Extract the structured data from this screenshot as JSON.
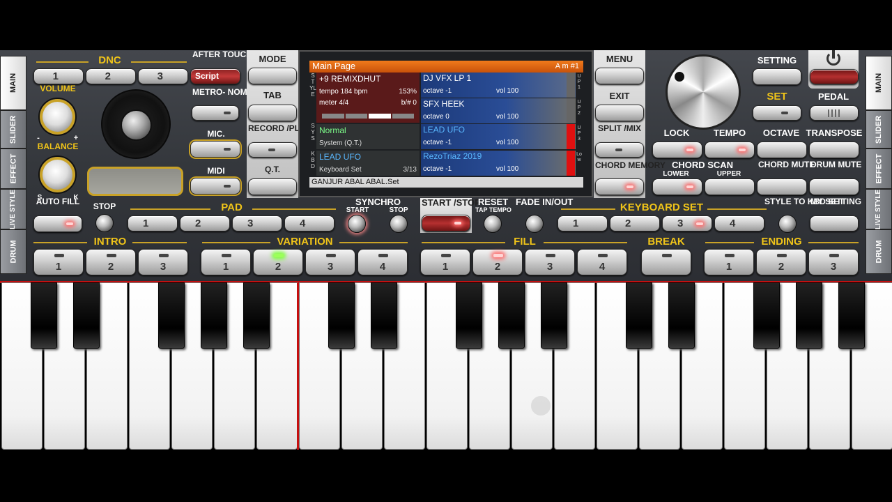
{
  "side_tabs_left": [
    "MAIN",
    "SLIDER",
    "EFFECT",
    "LIVE STYLE",
    "DRUM"
  ],
  "side_tabs_right": [
    "MAIN",
    "SLIDER",
    "EFFECT",
    "LIVE STYLE",
    "DRUM"
  ],
  "dnc": {
    "title": "DNC",
    "b1": "1",
    "b2": "2",
    "b3": "3",
    "script": "Script"
  },
  "after_touch": "AFTER TOUCH",
  "metronome": "METRO- NOME",
  "mic": "MIC.",
  "midi": "MIDI",
  "volume": "VOLUME",
  "balance": "BALANCE",
  "balance_s": "S",
  "balance_k": "K",
  "vol_minus": "-",
  "vol_plus": "+",
  "mode": "MODE",
  "tab": "TAB",
  "record_play": "RECORD /PLAY",
  "qt": "Q.T.",
  "menu": "MENU",
  "exit": "EXIT",
  "split_mix": "SPLIT /MIX",
  "chord_memory": "CHORD MEMORY",
  "screen": {
    "header_title": "Main Page",
    "header_chord": "A m #1",
    "style_name": "+9 REMIXDHUT",
    "tempo": "tempo 184 bpm",
    "tempo_pct": "153%",
    "meter": "meter 4/4",
    "bsharp": "b/# 0",
    "sys_name": "Normal",
    "sys_sub": "System (Q.T.)",
    "kbd_name": "LEAD UFO",
    "kbd_sub": "Keyboard Set",
    "kbd_count": "3/13",
    "side_style": "STYLE",
    "side_sys": "SYS",
    "side_kbd": "KBD",
    "parts": [
      {
        "name": "DJ VFX LP 1",
        "octave": "octave -1",
        "vol": "vol 100",
        "tag": "UP1"
      },
      {
        "name": "SFX HEEK",
        "octave": "octave  0",
        "vol": "vol 100",
        "tag": "UP2"
      },
      {
        "name": "LEAD UFO",
        "octave": "octave -1",
        "vol": "vol 100",
        "tag": "UP3"
      },
      {
        "name": "RezoTriaz 2019",
        "octave": "octave -1",
        "vol": "vol 100",
        "tag": "Low"
      }
    ],
    "footer": "GANJUR  ABAL ABAL.Set"
  },
  "setting": "SETTING",
  "set": "SET",
  "pedal": "PEDAL",
  "lock": "LOCK",
  "tempo_lbl": "TEMPO",
  "octave": "OCTAVE",
  "transpose": "TRANSPOSE",
  "chord_scan": "CHORD SCAN",
  "lower": "LOWER",
  "upper": "UPPER",
  "chord_mute": "CHORD MUTE",
  "drum_mute": "DRUM MUTE",
  "auto_fill": "AUTO FILL",
  "stop": "STOP",
  "pad": "PAD",
  "pad_buttons": [
    "1",
    "2",
    "3",
    "4"
  ],
  "synchro": "SYNCHRO",
  "synchro_start": "START",
  "synchro_stop": "STOP",
  "start_stop": "START /STOP",
  "reset": "RESET",
  "tap_tempo": "TAP TEMPO",
  "fade": "FADE IN/OUT",
  "keyboard_set": "KEYBOARD SET",
  "kbd_set_buttons": [
    "1",
    "2",
    "3",
    "4"
  ],
  "style_to_kbd": "STYLE TO KBD SET",
  "my_setting": "MY SETTING",
  "intro": "INTRO",
  "intro_buttons": [
    "1",
    "2",
    "3"
  ],
  "variation": "VARIATION",
  "variation_buttons": [
    "1",
    "2",
    "3",
    "4"
  ],
  "fill": "FILL",
  "fill_buttons": [
    "1",
    "2",
    "3",
    "4"
  ],
  "break": "BREAK",
  "ending": "ENDING",
  "ending_buttons": [
    "1",
    "2",
    "3"
  ],
  "colors": {
    "accent_gold": "#f0c419",
    "screen_header": "#e86a10",
    "led_green": "#7dff3a"
  }
}
